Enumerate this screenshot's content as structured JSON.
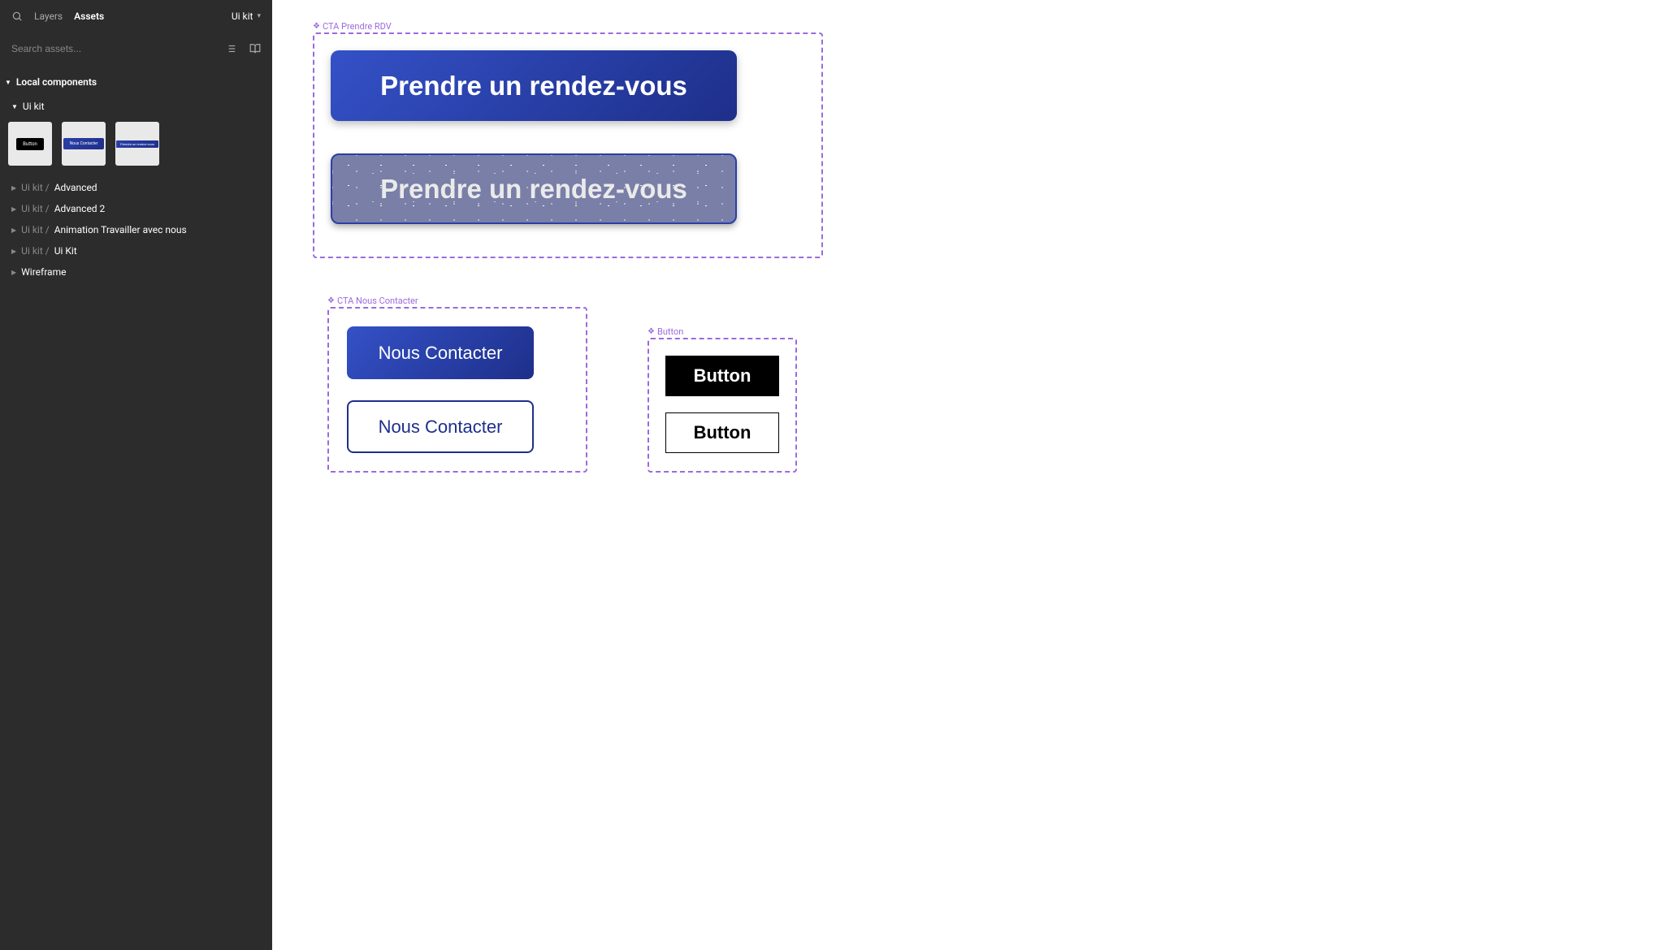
{
  "header": {
    "tab_layers": "Layers",
    "tab_assets": "Assets",
    "title": "Ui kit"
  },
  "search": {
    "placeholder": "Search assets..."
  },
  "sections": {
    "local_components": "Local components",
    "ui_kit": "Ui kit"
  },
  "thumbs": {
    "button": "Button",
    "nous_contacter": "Nous Contacter",
    "prendre_rdv": "Prendre un rendez-vous"
  },
  "tree": [
    {
      "prefix": "Ui kit /",
      "name": "Advanced"
    },
    {
      "prefix": "Ui kit /",
      "name": "Advanced 2"
    },
    {
      "prefix": "Ui kit /",
      "name": "Animation Travailler avec nous"
    },
    {
      "prefix": "Ui kit /",
      "name": "Ui Kit"
    },
    {
      "prefix": "",
      "name": "Wireframe"
    }
  ],
  "canvas": {
    "rdv": {
      "label": "CTA Prendre RDV",
      "primary": "Prendre un rendez-vous",
      "textured": "Prendre un rendez-vous"
    },
    "contact": {
      "label": "CTA Nous Contacter",
      "filled": "Nous Contacter",
      "outline": "Nous Contacter"
    },
    "button": {
      "label": "Button",
      "black": "Button",
      "white": "Button"
    }
  },
  "colors": {
    "purple": "#9c6ade",
    "blue_dark": "#1e2f8a",
    "blue_light": "#3451c7",
    "sidebar_bg": "#2c2c2c"
  }
}
